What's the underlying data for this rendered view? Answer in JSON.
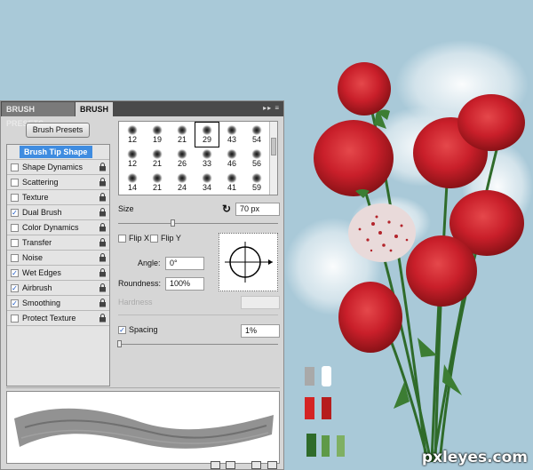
{
  "tabs": {
    "presets": "BRUSH PRESETS",
    "brush": "BRUSH"
  },
  "panel_menu_icon": "panel-menu-icon",
  "brush_presets_button": "Brush Presets",
  "settings_list": [
    {
      "label": "Brush Tip Shape",
      "checked": null,
      "selected": true,
      "lock": false
    },
    {
      "label": "Shape Dynamics",
      "checked": false,
      "selected": false,
      "lock": true
    },
    {
      "label": "Scattering",
      "checked": false,
      "selected": false,
      "lock": true
    },
    {
      "label": "Texture",
      "checked": false,
      "selected": false,
      "lock": true
    },
    {
      "label": "Dual Brush",
      "checked": true,
      "selected": false,
      "lock": true
    },
    {
      "label": "Color Dynamics",
      "checked": false,
      "selected": false,
      "lock": true
    },
    {
      "label": "Transfer",
      "checked": false,
      "selected": false,
      "lock": true
    },
    {
      "label": "Noise",
      "checked": false,
      "selected": false,
      "lock": true
    },
    {
      "label": "Wet Edges",
      "checked": true,
      "selected": false,
      "lock": true
    },
    {
      "label": "Airbrush",
      "checked": true,
      "selected": false,
      "lock": true
    },
    {
      "label": "Smoothing",
      "checked": true,
      "selected": false,
      "lock": true
    },
    {
      "label": "Protect Texture",
      "checked": false,
      "selected": false,
      "lock": true
    }
  ],
  "brush_tips": [
    [
      "12",
      "19",
      "21",
      "29",
      "43",
      "54"
    ],
    [
      "12",
      "21",
      "26",
      "33",
      "46",
      "56"
    ],
    [
      "14",
      "21",
      "24",
      "34",
      "41",
      "59"
    ]
  ],
  "selected_tip": "29",
  "size": {
    "label": "Size",
    "value": "70 px"
  },
  "flip_x": {
    "label": "Flip X",
    "checked": false
  },
  "flip_y": {
    "label": "Flip Y",
    "checked": false
  },
  "angle": {
    "label": "Angle:",
    "value": "0°"
  },
  "roundness": {
    "label": "Roundness:",
    "value": "100%"
  },
  "hardness": {
    "label": "Hardness",
    "value": ""
  },
  "spacing": {
    "label": "Spacing",
    "checked": true,
    "value": "1%"
  },
  "watermark": "pxleyes.com",
  "swatches": [
    "#a9a9a9",
    "#ffffff",
    "#d42424",
    "#b61d1d",
    "#2f6b2a",
    "#5f9a48",
    "#7fb063"
  ]
}
